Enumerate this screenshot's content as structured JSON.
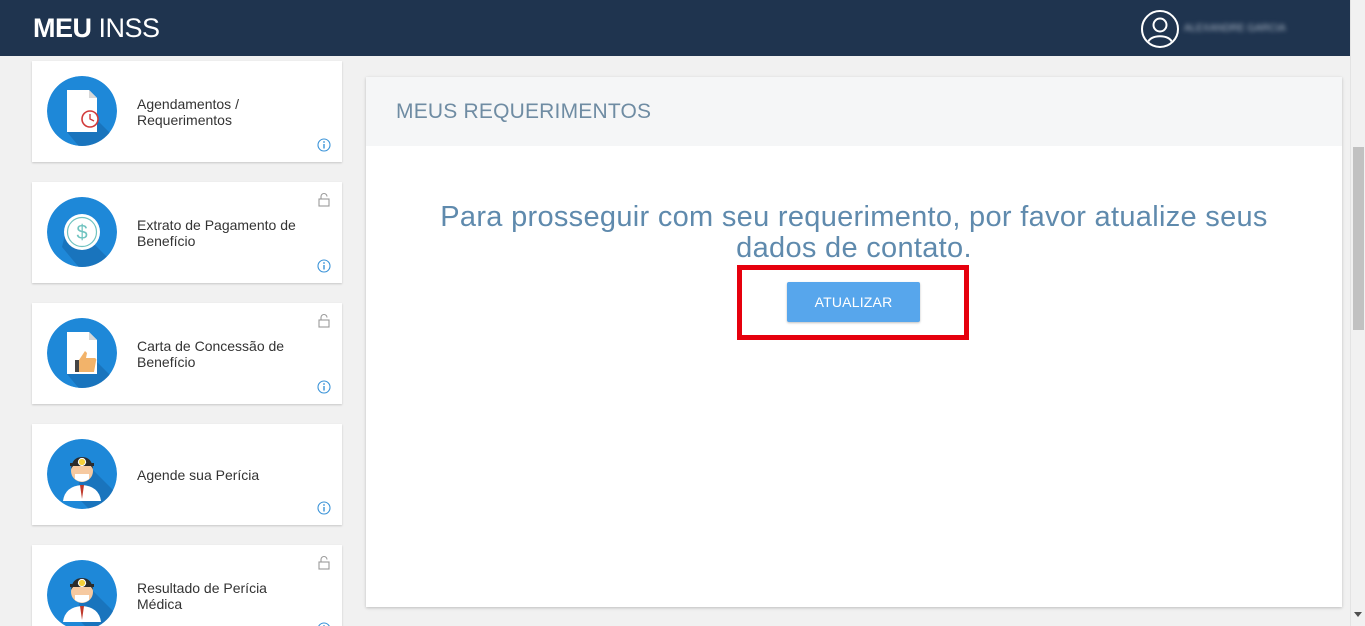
{
  "header": {
    "brand_bold": "MEU",
    "brand_light": "INSS",
    "user_name": "ALEXANDRE GARCIA",
    "avatar_icon": "user-circle-icon",
    "background": "#1f344f"
  },
  "sidebar": {
    "items": [
      {
        "label": "Agendamentos / Requerimentos",
        "icon": "document-clock-icon",
        "locked": false,
        "info": true
      },
      {
        "label": "Extrato de Pagamento de Benefício",
        "icon": "dollar-icon",
        "locked": true,
        "info": true
      },
      {
        "label": "Carta de Concessão de Benefício",
        "icon": "document-thumbs-up-icon",
        "locked": true,
        "info": true
      },
      {
        "label": "Agende sua Perícia",
        "icon": "doctor-icon",
        "locked": false,
        "info": true
      },
      {
        "label": "Resultado de Perícia Médica",
        "icon": "doctor-icon",
        "locked": true,
        "info": true
      }
    ],
    "circle_color": "#1e88d8"
  },
  "main": {
    "title": "MEUS REQUERIMENTOS",
    "message": "Para prosseguir com seu requerimento, por favor atualize seus dados de contato.",
    "button_label": "ATUALIZAR",
    "button_color": "#57a6ec",
    "highlight_color": "#e6000d"
  }
}
